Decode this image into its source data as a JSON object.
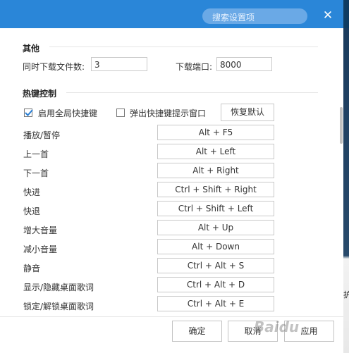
{
  "header": {
    "search_placeholder": "搜索设置项"
  },
  "other": {
    "title": "其他",
    "concurrent_label": "同时下载文件数:",
    "concurrent_value": "3",
    "port_label": "下载端口:",
    "port_value": "8000"
  },
  "hotkeys": {
    "title": "热键控制",
    "enable_global_label": "启用全局快捷键",
    "enable_global_checked": true,
    "popup_conflict_label": "弹出快捷键提示窗口",
    "popup_conflict_checked": false,
    "restore_default_label": "恢复默认",
    "items": [
      {
        "action": "播放/暂停",
        "key": "Alt + F5"
      },
      {
        "action": "上一首",
        "key": "Alt + Left"
      },
      {
        "action": "下一首",
        "key": "Alt + Right"
      },
      {
        "action": "快进",
        "key": "Ctrl + Shift + Right"
      },
      {
        "action": "快退",
        "key": "Ctrl + Shift + Left"
      },
      {
        "action": "增大音量",
        "key": "Alt + Up"
      },
      {
        "action": "减小音量",
        "key": "Alt + Down"
      },
      {
        "action": "静音",
        "key": "Ctrl + Alt + S"
      },
      {
        "action": "显示/隐藏桌面歌词",
        "key": "Ctrl + Alt + D"
      },
      {
        "action": "锁定/解锁桌面歌词",
        "key": "Ctrl + Alt + E"
      }
    ]
  },
  "footer": {
    "ok_label": "确定",
    "cancel_label": "取消",
    "apply_label": "应用"
  },
  "watermark": "Baidu",
  "background_edge_text": "护",
  "colors": {
    "titlebar": "#2a86d8",
    "search_bg": "#6aa9e6",
    "checkbox_check": "#2a7fd4"
  },
  "icons": {
    "close": "close-icon",
    "check": "check-icon"
  }
}
